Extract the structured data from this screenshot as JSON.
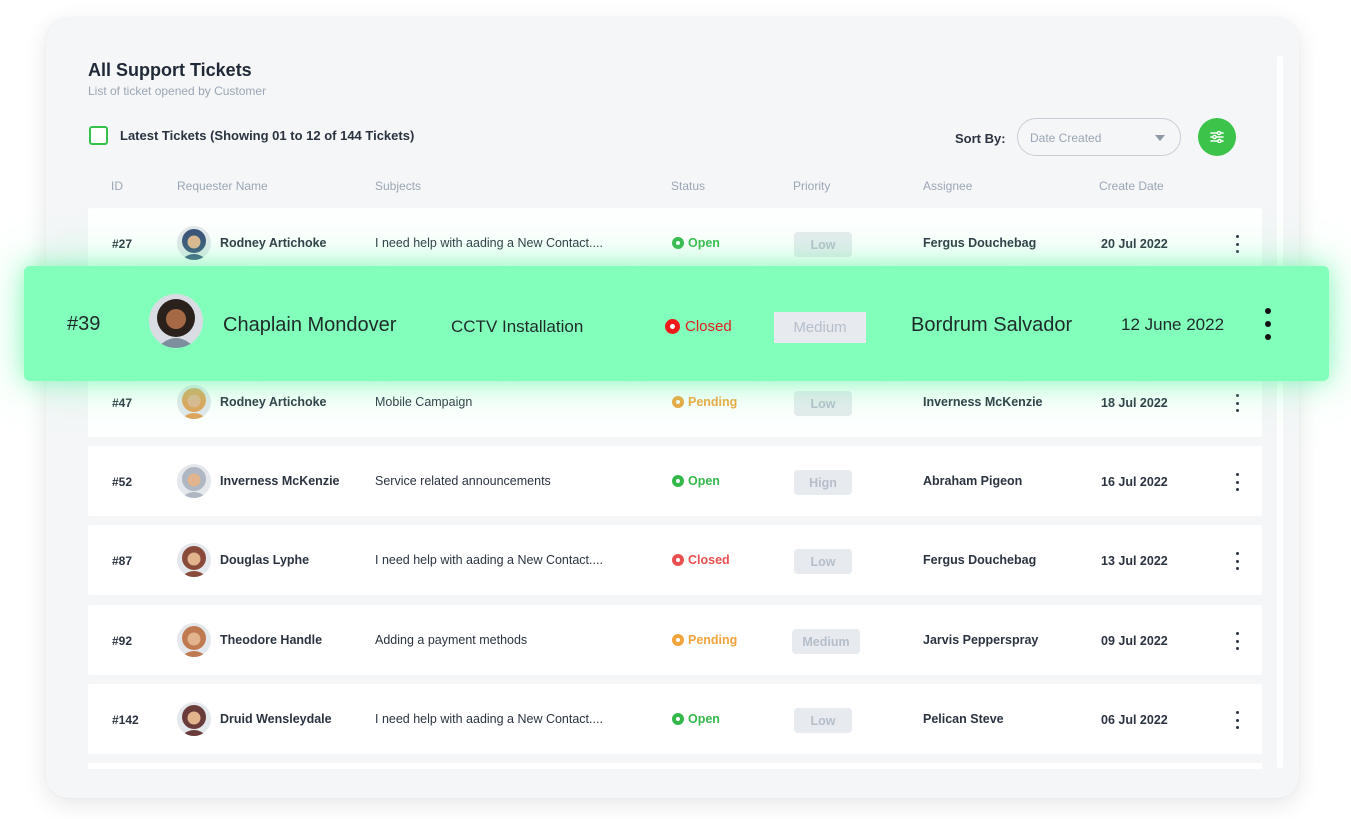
{
  "header": {
    "title": "All Support Tickets",
    "subtitle": "List of ticket opened by Customer",
    "latest_label": "Latest Tickets (Showing 01 to 12 of 144 Tickets)",
    "sort_label": "Sort By:",
    "sort_value": "Date Created"
  },
  "columns": {
    "id": "ID",
    "requester": "Requester Name",
    "subjects": "Subjects",
    "status": "Status",
    "priority": "Priority",
    "assignee": "Assignee",
    "date": "Create Date"
  },
  "status_colors": {
    "Open": "#35b84a",
    "Pending": "#f0a43c",
    "Closed": "#e8504f"
  },
  "rows": [
    {
      "id": "#27",
      "name": "Rodney Artichoke",
      "subject": "I need help with aading a New Contact....",
      "status": "Open",
      "priority": "Low",
      "assignee": "Fergus Douchebag",
      "date": "20 Jul 2022",
      "avatar_color": "#3a4f78"
    },
    {
      "id": "#47",
      "name": "Rodney Artichoke",
      "subject": "Mobile Campaign",
      "status": "Pending",
      "priority": "Low",
      "assignee": "Inverness McKenzie",
      "date": "18 Jul 2022",
      "avatar_color": "#e0a25a"
    },
    {
      "id": "#52",
      "name": "Inverness McKenzie",
      "subject": "Service related announcements",
      "status": "Open",
      "priority": "Hign",
      "assignee": "Abraham Pigeon",
      "date": "16 Jul 2022",
      "avatar_color": "#aeb7c2"
    },
    {
      "id": "#87",
      "name": "Douglas Lyphe",
      "subject": "I need help with aading a New Contact....",
      "status": "Closed",
      "priority": "Low",
      "assignee": "Fergus Douchebag",
      "date": "13 Jul 2022",
      "avatar_color": "#8a4a3a"
    },
    {
      "id": "#92",
      "name": "Theodore Handle",
      "subject": "Adding a payment methods",
      "status": "Pending",
      "priority": "Medium",
      "assignee": "Jarvis Pepperspray",
      "date": "09 Jul 2022",
      "avatar_color": "#c07a52"
    },
    {
      "id": "#142",
      "name": "Druid Wensleydale",
      "subject": "I need help with aading a New Contact....",
      "status": "Open",
      "priority": "Low",
      "assignee": "Pelican Steve",
      "date": "06 Jul 2022",
      "avatar_color": "#6a3b3b"
    }
  ],
  "highlight": {
    "id": "#39",
    "name": "Chaplain Mondover",
    "subject": "CCTV Installation",
    "status": "Closed",
    "priority": "Medium",
    "assignee": "Bordrum Salvador",
    "date": "12 June 2022",
    "accent": "#83ffbc"
  },
  "icons": {
    "filter": "sliders-icon",
    "sort_caret": "caret-down-icon",
    "row_menu": "kebab-menu-icon"
  }
}
